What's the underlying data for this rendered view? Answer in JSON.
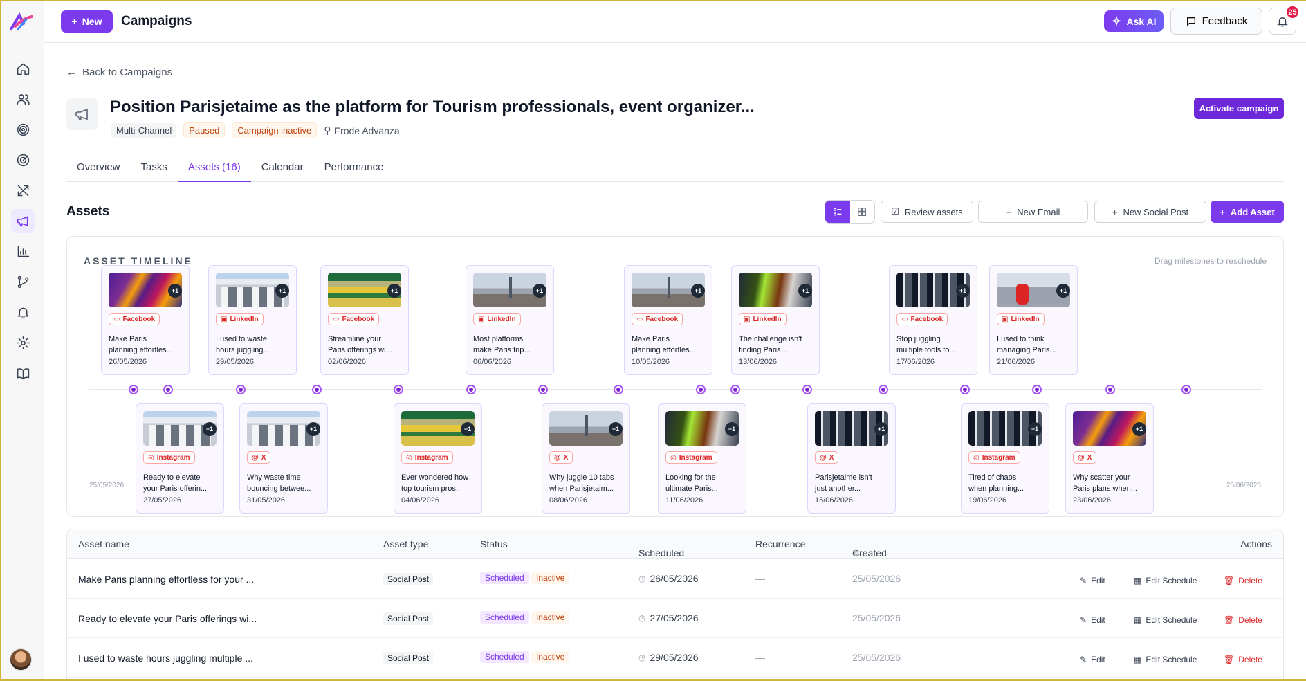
{
  "topbar": {
    "new_label": "New",
    "title": "Campaigns",
    "ask_ai": "Ask AI",
    "feedback": "Feedback",
    "notifications": "25"
  },
  "rail": {
    "items": [
      "home-icon",
      "users-icon",
      "target-icon",
      "radar-icon",
      "tools-icon",
      "megaphone-icon",
      "chart-icon",
      "branch-icon",
      "bell-icon",
      "settings-icon",
      "book-icon"
    ],
    "active": "megaphone-icon"
  },
  "campaign": {
    "back": "Back to Campaigns",
    "title": "Position Parisjetaime as the platform for Tourism professionals, event organizer...",
    "chips": [
      "Multi-Channel",
      "Paused",
      "Campaign inactive"
    ],
    "owner": "Frode Advanza",
    "activate": "Activate campaign"
  },
  "tabs": [
    "Overview",
    "Tasks",
    "Assets (16)",
    "Calendar",
    "Performance"
  ],
  "assets": {
    "heading": "Assets",
    "review": "Review assets",
    "new_email": "New Email",
    "new_social": "New Social Post",
    "add": "Add Asset"
  },
  "timeline": {
    "title": "ASSET TIMELINE",
    "hint": "Drag milestones to reschedule",
    "start": "25/05/2026",
    "end": "25/06/2026",
    "top": [
      {
        "img": "fest",
        "platform": "Facebook",
        "text": "Make Paris\nplanning effortles...",
        "date": "26/05/2026"
      },
      {
        "img": "arch",
        "platform": "LinkedIn",
        "text": "I used to waste\nhours juggling...",
        "date": "29/05/2026"
      },
      {
        "img": "garden",
        "platform": "Facebook",
        "text": "Streamline your\nParis offerings wi...",
        "date": "02/06/2026"
      },
      {
        "img": "city",
        "platform": "LinkedIn",
        "text": "Most platforms\nmake Paris trip...",
        "date": "06/06/2026"
      },
      {
        "img": "city",
        "platform": "Facebook",
        "text": "Make Paris\nplanning effortles...",
        "date": "10/06/2026"
      },
      {
        "img": "street",
        "platform": "LinkedIn",
        "text": "The challenge isn't\nfinding Paris...",
        "date": "13/06/2026"
      },
      {
        "img": "metro",
        "platform": "Facebook",
        "text": "Stop juggling\nmultiple tools to...",
        "date": "17/06/2026"
      },
      {
        "img": "people",
        "platform": "LinkedIn",
        "text": "I used to think\nmanaging Paris...",
        "date": "21/06/2026"
      }
    ],
    "bottom": [
      {
        "img": "arch",
        "platform": "Instagram",
        "text": "Ready to elevate\nyour Paris offerin...",
        "date": "27/05/2026"
      },
      {
        "img": "arch",
        "platform": "X",
        "text": "Why waste time\nbouncing betwee...",
        "date": "31/05/2026"
      },
      {
        "img": "garden",
        "platform": "Instagram",
        "text": "Ever wondered how\ntop tourism pros...",
        "date": "04/06/2026"
      },
      {
        "img": "city",
        "platform": "X",
        "text": "Why juggle 10 tabs\nwhen Parisjetaim...",
        "date": "08/06/2026"
      },
      {
        "img": "street",
        "platform": "Instagram",
        "text": "Looking for the\nultimate Paris...",
        "date": "11/06/2026"
      },
      {
        "img": "metro",
        "platform": "X",
        "text": "Parisjetaime isn't\njust another...",
        "date": "15/06/2026"
      },
      {
        "img": "metro",
        "platform": "Instagram",
        "text": "Tired of chaos\nwhen planning...",
        "date": "19/06/2026"
      },
      {
        "img": "fest",
        "platform": "X",
        "text": "Why scatter your\nParis plans when...",
        "date": "23/06/2026"
      }
    ],
    "more": "+1"
  },
  "table": {
    "headers": [
      "Asset name",
      "Asset type",
      "Status",
      "Scheduled",
      "Recurrence",
      "Created",
      "Actions"
    ],
    "rows": [
      {
        "name": "Make Paris planning effortless for your ...",
        "type": "Social Post",
        "status": "Scheduled",
        "state": "Inactive",
        "scheduled": "26/05/2026",
        "recurrence": "—",
        "created": "25/05/2026"
      },
      {
        "name": "Ready to elevate your Paris offerings wi...",
        "type": "Social Post",
        "status": "Scheduled",
        "state": "Inactive",
        "scheduled": "27/05/2026",
        "recurrence": "—",
        "created": "25/05/2026"
      },
      {
        "name": "I used to waste hours juggling multiple ...",
        "type": "Social Post",
        "status": "Scheduled",
        "state": "Inactive",
        "scheduled": "29/05/2026",
        "recurrence": "—",
        "created": "25/05/2026"
      }
    ],
    "actions": {
      "edit": "Edit",
      "edit_schedule": "Edit Schedule",
      "delete": "Delete"
    }
  }
}
